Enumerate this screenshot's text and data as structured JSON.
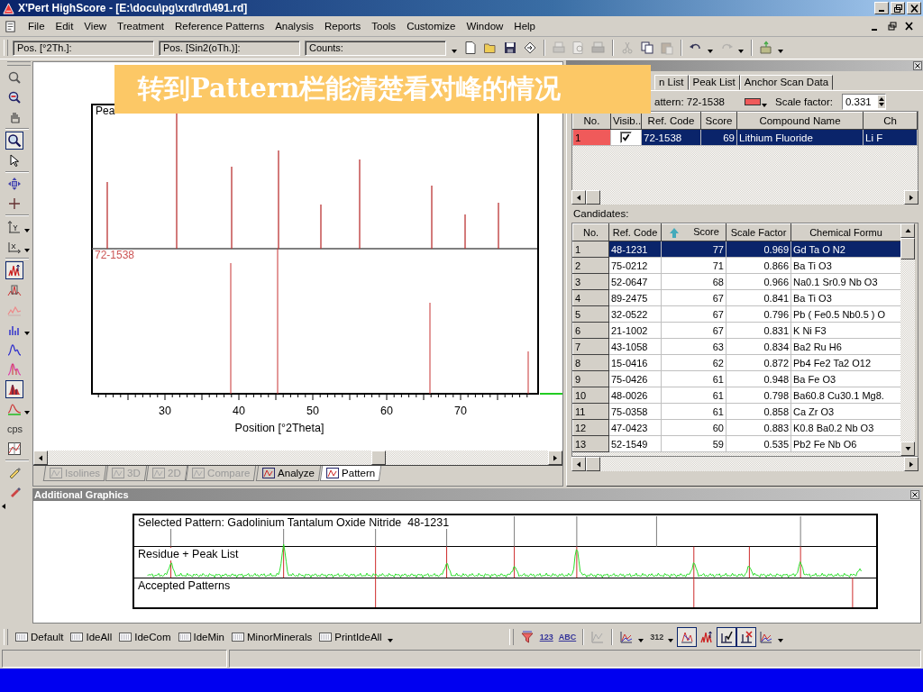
{
  "window": {
    "title": "X'Pert HighScore - [E:\\docu\\pg\\xrd\\rd\\491.rd]"
  },
  "menu": [
    "File",
    "Edit",
    "View",
    "Treatment",
    "Reference Patterns",
    "Analysis",
    "Reports",
    "Tools",
    "Customize",
    "Window",
    "Help"
  ],
  "toolbar": {
    "readouts": [
      {
        "label": "Pos. [°2Th.]:",
        "kind": "field"
      },
      {
        "label": "Pos. [Sin2(oTh.)]:",
        "kind": "field"
      },
      {
        "label": "Counts:",
        "kind": "dropdown"
      }
    ],
    "tools": [
      {
        "kind": "new",
        "disabled": false
      },
      {
        "kind": "open",
        "disabled": false
      },
      {
        "kind": "save",
        "disabled": false
      },
      {
        "kind": "import",
        "disabled": false
      },
      {
        "kind": "sep"
      },
      {
        "kind": "print",
        "disabled": true
      },
      {
        "kind": "preview",
        "disabled": true
      },
      {
        "kind": "printer-setup",
        "disabled": true
      },
      {
        "kind": "sep"
      },
      {
        "kind": "cut",
        "disabled": true
      },
      {
        "kind": "copy",
        "disabled": false
      },
      {
        "kind": "paste",
        "disabled": true
      },
      {
        "kind": "sep"
      },
      {
        "kind": "undo",
        "disabled": false
      },
      {
        "kind": "redo",
        "disabled": true
      },
      {
        "kind": "sep"
      },
      {
        "kind": "export",
        "disabled": false
      }
    ]
  },
  "caption": "转到Pattern栏能清楚看对峰的情况",
  "side_tools": [
    {
      "kind": "zoom-fit",
      "pressed": false
    },
    {
      "kind": "zoom-out",
      "pressed": false
    },
    {
      "kind": "pan",
      "pressed": false
    },
    {
      "kind": "sep"
    },
    {
      "kind": "zoom",
      "pressed": true
    },
    {
      "kind": "pointer",
      "pressed": false
    },
    {
      "kind": "sep"
    },
    {
      "kind": "move",
      "pressed": false
    },
    {
      "kind": "crosshair",
      "pressed": false
    },
    {
      "kind": "sep"
    },
    {
      "kind": "y-scale",
      "pressed": false
    },
    {
      "kind": "x-scale",
      "pressed": false
    },
    {
      "kind": "sep"
    },
    {
      "kind": "peaks",
      "pressed": true
    },
    {
      "kind": "peak-box",
      "pressed": false
    },
    {
      "kind": "profile",
      "pressed": false
    },
    {
      "kind": "bars",
      "pressed": false
    },
    {
      "kind": "curve",
      "pressed": false
    },
    {
      "kind": "curve-pink",
      "pressed": false
    },
    {
      "kind": "peak-fill",
      "pressed": true
    },
    {
      "kind": "curve-green",
      "pressed": false
    },
    {
      "kind": "text",
      "label": "cps"
    },
    {
      "kind": "grid-chart",
      "pressed": false
    },
    {
      "kind": "sep"
    },
    {
      "kind": "pen",
      "pressed": false
    },
    {
      "kind": "brush",
      "pressed": false
    }
  ],
  "pattern_view": {
    "upper_label": "Pea",
    "lower_label": "72-1538",
    "x_ticks": [
      "30",
      "40",
      "50",
      "60",
      "70"
    ],
    "x_axis_label": "Position [°2Theta]",
    "tabs": [
      {
        "label": "Isolines",
        "disabled": true,
        "selected": false
      },
      {
        "label": "3D",
        "disabled": true,
        "selected": false
      },
      {
        "label": "2D",
        "disabled": true,
        "selected": false
      },
      {
        "label": "Compare",
        "disabled": true,
        "selected": false
      },
      {
        "label": "Analyze",
        "disabled": false,
        "selected": false
      },
      {
        "label": "Pattern",
        "disabled": false,
        "selected": true
      }
    ]
  },
  "match_panel": {
    "tabs": [
      {
        "label": "n List",
        "selected": false
      },
      {
        "label": "Peak List",
        "selected": false
      },
      {
        "label": "Anchor Scan Data",
        "selected": false
      }
    ],
    "pattern_label": "attern: 72-1538",
    "scale_factor_label": "Scale factor:",
    "scale_factor": "0.331",
    "accepted": {
      "columns": [
        "No.",
        "Visib..",
        "Ref. Code",
        "Score",
        "Compound Name",
        "Ch"
      ],
      "rows": [
        {
          "no": "1",
          "color": "#f05a5a",
          "visible": true,
          "ref_code": "72-1538",
          "score": "69",
          "compound": "Lithium Fluoride",
          "formula": "Li F",
          "selected": true
        }
      ]
    },
    "candidates_label": "Candidates:",
    "candidates": {
      "columns": [
        "No.",
        "Ref. Code",
        "Score",
        "Scale Factor",
        "Chemical Formu"
      ],
      "rows": [
        {
          "no": "1",
          "ref_code": "48-1231",
          "score": "77",
          "scale": "0.969",
          "formula": "Gd Ta O N2",
          "selected": true
        },
        {
          "no": "2",
          "ref_code": "75-0212",
          "score": "71",
          "scale": "0.866",
          "formula": "Ba Ti O3",
          "selected": false
        },
        {
          "no": "3",
          "ref_code": "52-0647",
          "score": "68",
          "scale": "0.966",
          "formula": "Na0.1 Sr0.9 Nb O3",
          "selected": false
        },
        {
          "no": "4",
          "ref_code": "89-2475",
          "score": "67",
          "scale": "0.841",
          "formula": "Ba Ti O3",
          "selected": false
        },
        {
          "no": "5",
          "ref_code": "32-0522",
          "score": "67",
          "scale": "0.796",
          "formula": "Pb ( Fe0.5 Nb0.5 ) O",
          "selected": false
        },
        {
          "no": "6",
          "ref_code": "21-1002",
          "score": "67",
          "scale": "0.831",
          "formula": "K Ni F3",
          "selected": false
        },
        {
          "no": "7",
          "ref_code": "43-1058",
          "score": "63",
          "scale": "0.834",
          "formula": "Ba2 Ru H6",
          "selected": false
        },
        {
          "no": "8",
          "ref_code": "15-0416",
          "score": "62",
          "scale": "0.872",
          "formula": "Pb4 Fe2 Ta2 O12",
          "selected": false
        },
        {
          "no": "9",
          "ref_code": "75-0426",
          "score": "61",
          "scale": "0.948",
          "formula": "Ba Fe O3",
          "selected": false
        },
        {
          "no": "10",
          "ref_code": "48-0026",
          "score": "61",
          "scale": "0.798",
          "formula": "Ba60.8 Cu30.1 Mg8.",
          "selected": false
        },
        {
          "no": "11",
          "ref_code": "75-0358",
          "score": "61",
          "scale": "0.858",
          "formula": "Ca Zr O3",
          "selected": false
        },
        {
          "no": "12",
          "ref_code": "47-0423",
          "score": "60",
          "scale": "0.883",
          "formula": "K0.8 Ba0.2 Nb O3",
          "selected": false
        },
        {
          "no": "13",
          "ref_code": "52-1549",
          "score": "59",
          "scale": "0.535",
          "formula": "Pb2 Fe Nb O6",
          "selected": false
        }
      ]
    }
  },
  "additional_graphics": {
    "title": "Additional Graphics",
    "bands": [
      "Selected Pattern: Gadolinium Tantalum Oxide Nitride  48-1231",
      "Residue + Peak List",
      "Accepted Patterns"
    ]
  },
  "bottom_toolbar": {
    "buttons": [
      "Default",
      "IdeAll",
      "IdeCom",
      "IdeMin",
      "MinorMinerals",
      "PrintIdeAll"
    ],
    "tools": [
      {
        "kind": "filter",
        "pressed": false
      },
      {
        "kind": "labels",
        "label": "123",
        "pressed": false
      },
      {
        "kind": "labels",
        "label": "ABC",
        "pressed": false
      },
      {
        "kind": "sep"
      },
      {
        "kind": "chart-grey",
        "pressed": false
      },
      {
        "kind": "sep"
      },
      {
        "kind": "chart-menu",
        "pressed": false
      },
      {
        "kind": "sort",
        "label": "312",
        "pressed": false
      },
      {
        "kind": "match",
        "pressed": true
      },
      {
        "kind": "peaks",
        "pressed": false
      },
      {
        "kind": "accept",
        "pressed": true
      },
      {
        "kind": "reject",
        "pressed": true
      },
      {
        "kind": "chart-menu",
        "pressed": false
      }
    ]
  }
}
